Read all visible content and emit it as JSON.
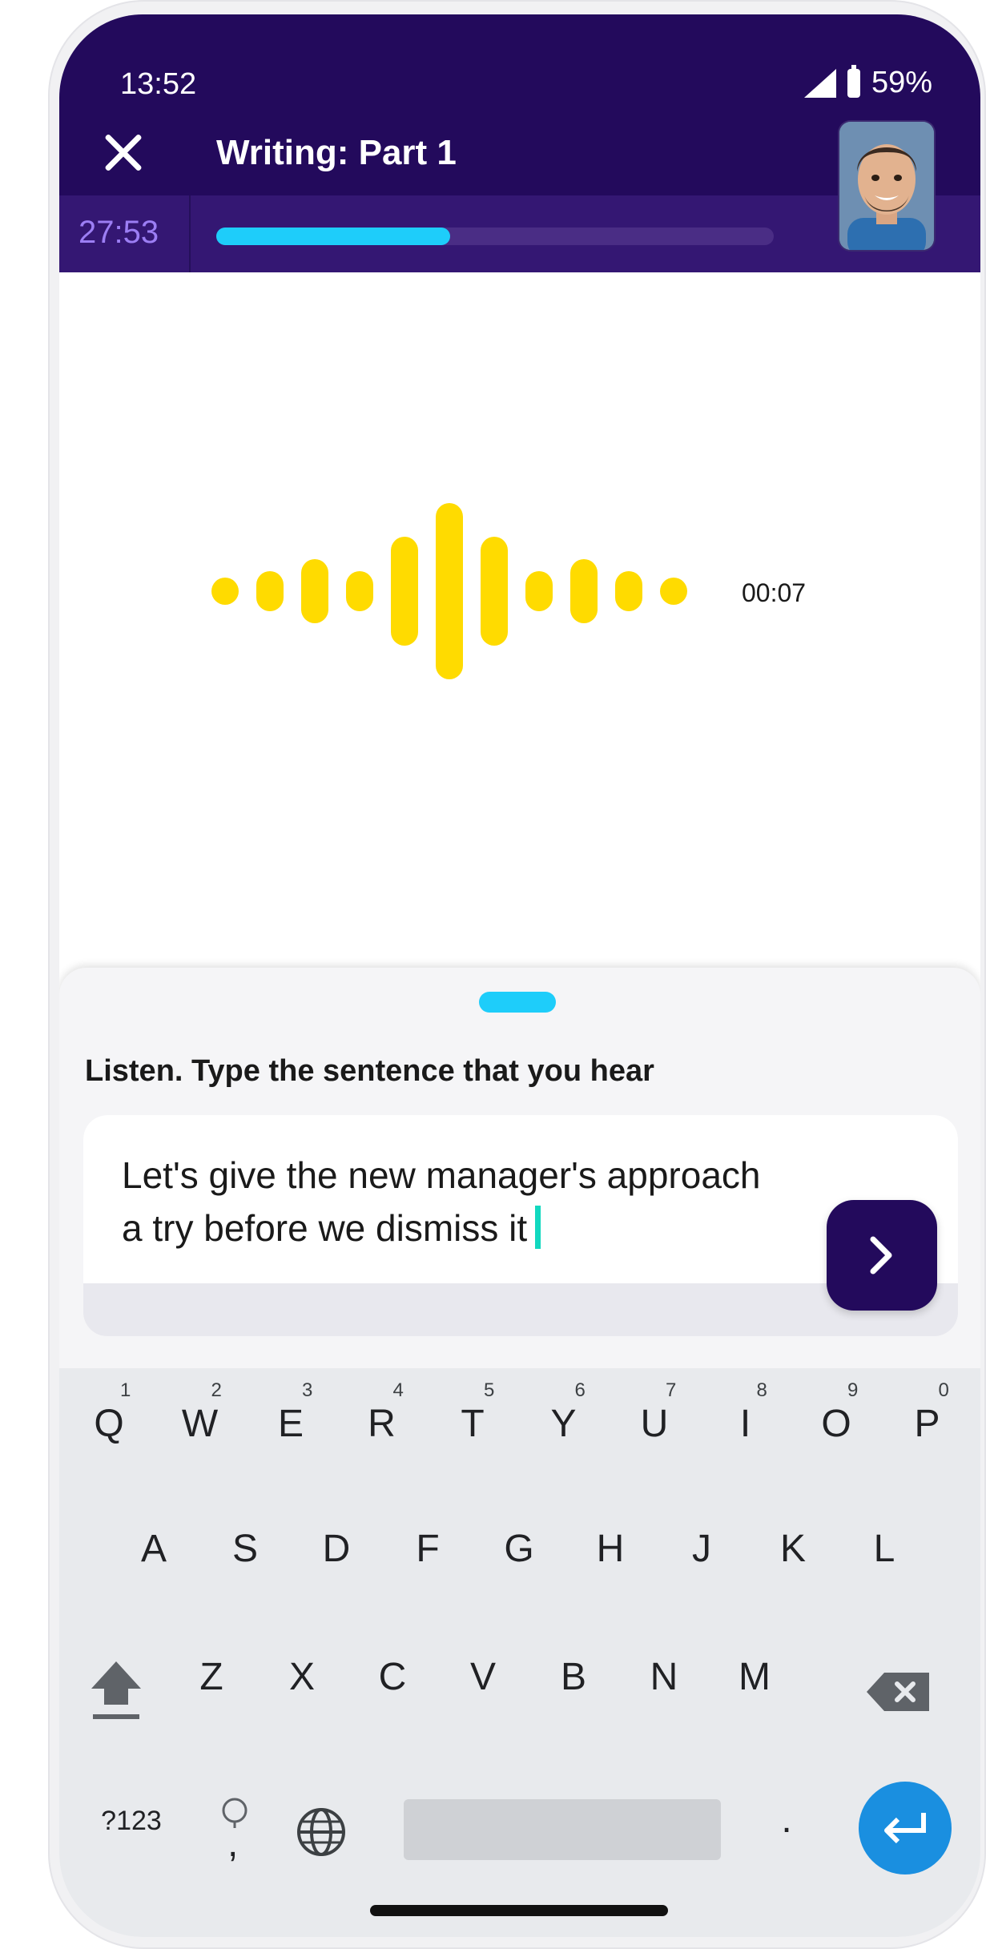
{
  "status_bar": {
    "time": "13:52",
    "battery": "59%"
  },
  "header": {
    "title": "Writing: Part 1",
    "close_icon": "close-icon"
  },
  "timer": {
    "remaining": "27:53",
    "progress": 0.42
  },
  "audio": {
    "duration": "00:07",
    "wave_color": "#ffdb00"
  },
  "task": {
    "instruction": "Listen. Type the sentence that you hear",
    "answer_line1": "Let's give the new manager's approach",
    "answer_line2": "a try before we dismiss it"
  },
  "keyboard": {
    "row1": [
      {
        "k": "Q",
        "h": "1"
      },
      {
        "k": "W",
        "h": "2"
      },
      {
        "k": "E",
        "h": "3"
      },
      {
        "k": "R",
        "h": "4"
      },
      {
        "k": "T",
        "h": "5"
      },
      {
        "k": "Y",
        "h": "6"
      },
      {
        "k": "U",
        "h": "7"
      },
      {
        "k": "I",
        "h": "8"
      },
      {
        "k": "O",
        "h": "9"
      },
      {
        "k": "P",
        "h": "0"
      }
    ],
    "row2": [
      "A",
      "S",
      "D",
      "F",
      "G",
      "H",
      "J",
      "K",
      "L"
    ],
    "row3": [
      "Z",
      "X",
      "C",
      "V",
      "B",
      "N",
      "M"
    ],
    "symbols_label": "?123",
    "comma": ",",
    "period": "."
  },
  "colors": {
    "header": "#230a5c",
    "accent": "#1ecdfa",
    "timer_text": "#9c7ef4",
    "caret": "#12d8bf",
    "enter": "#1a8fe0"
  }
}
